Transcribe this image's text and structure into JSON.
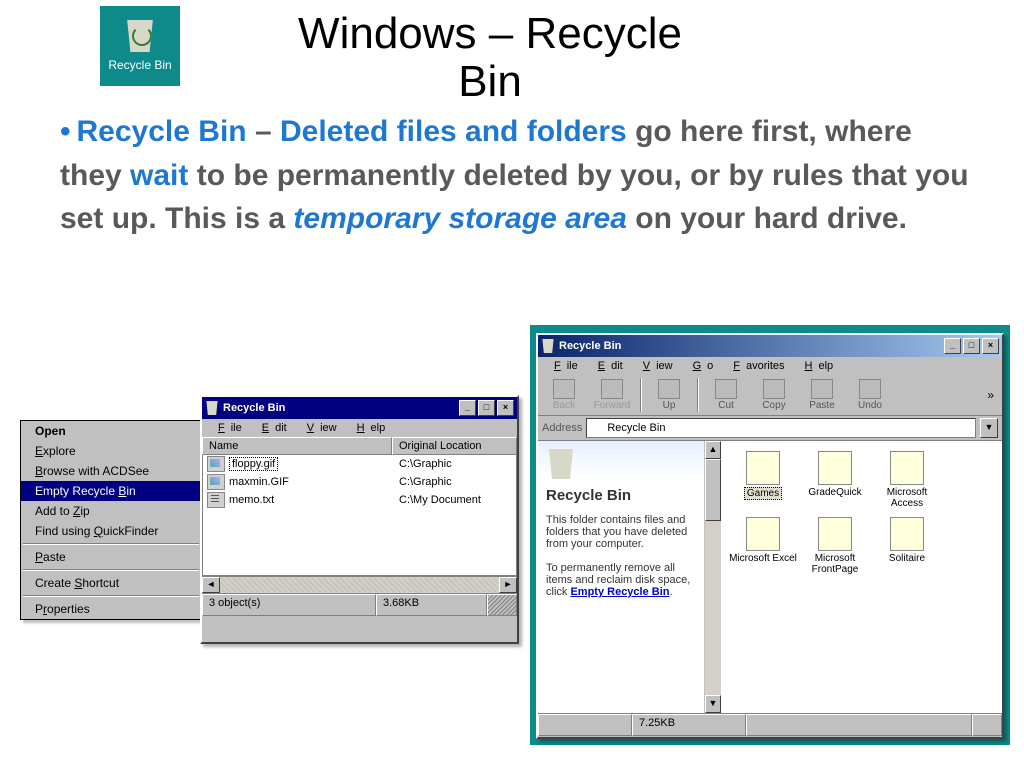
{
  "slide": {
    "title": "Windows – Recycle Bin",
    "desktop_icon_label": "Recycle Bin",
    "bullet": "•",
    "text": {
      "kw1": "Recycle Bin",
      "dash": " – ",
      "kw2": "Deleted files and folders",
      "p1": " go here first, where they ",
      "kw3": "wait",
      "p2": " to be permanently deleted by you, or by rules that you set up. This is a ",
      "kw4": "temporary storage area",
      "p3": " on your hard drive."
    }
  },
  "context_menu": {
    "items": [
      {
        "label": "Open",
        "bold": true
      },
      {
        "label": "Explore",
        "u": 0
      },
      {
        "label": "Browse with ACDSee",
        "u": 0
      },
      {
        "label": "Empty Recycle Bin",
        "u": 14,
        "selected": true
      },
      {
        "label": "Add to Zip",
        "u": 7
      },
      {
        "label": "Find using QuickFinder",
        "u": 11
      }
    ],
    "paste": "Paste",
    "shortcut": "Create Shortcut",
    "properties": "Properties"
  },
  "win_small": {
    "title": "Recycle Bin",
    "menus": [
      "File",
      "Edit",
      "View",
      "Help"
    ],
    "cols": [
      "Name",
      "Original Location"
    ],
    "rows": [
      {
        "name": "floppy.gif",
        "loc": "C:\\Graphic",
        "type": "img",
        "sel": true
      },
      {
        "name": "maxmin.GIF",
        "loc": "C:\\Graphic",
        "type": "img"
      },
      {
        "name": "memo.txt",
        "loc": "C:\\My Document",
        "type": "txt"
      }
    ],
    "status_left": "3 object(s)",
    "status_right": "3.68KB"
  },
  "win_large": {
    "title": "Recycle Bin",
    "menus": [
      "File",
      "Edit",
      "View",
      "Go",
      "Favorites",
      "Help"
    ],
    "toolbar": [
      {
        "label": "Back",
        "disabled": true
      },
      {
        "label": "Forward",
        "disabled": true
      },
      {
        "label": "Up"
      },
      {
        "label": "Cut"
      },
      {
        "label": "Copy"
      },
      {
        "label": "Paste"
      },
      {
        "label": "Undo"
      }
    ],
    "address_label": "Address",
    "address_value": "Recycle Bin",
    "left_pane": {
      "title": "Recycle Bin",
      "p1": "This folder contains files and folders that you have deleted from your computer.",
      "p2a": "To permanently remove all items and reclaim disk space, click ",
      "link": "Empty Recycle Bin",
      "p2b": "."
    },
    "icons": [
      {
        "label": "Games",
        "selected": true
      },
      {
        "label": "GradeQuick"
      },
      {
        "label": "Microsoft Access"
      },
      {
        "label": "Microsoft Excel"
      },
      {
        "label": "Microsoft FrontPage"
      },
      {
        "label": "Solitaire"
      }
    ],
    "status": "7.25KB"
  }
}
